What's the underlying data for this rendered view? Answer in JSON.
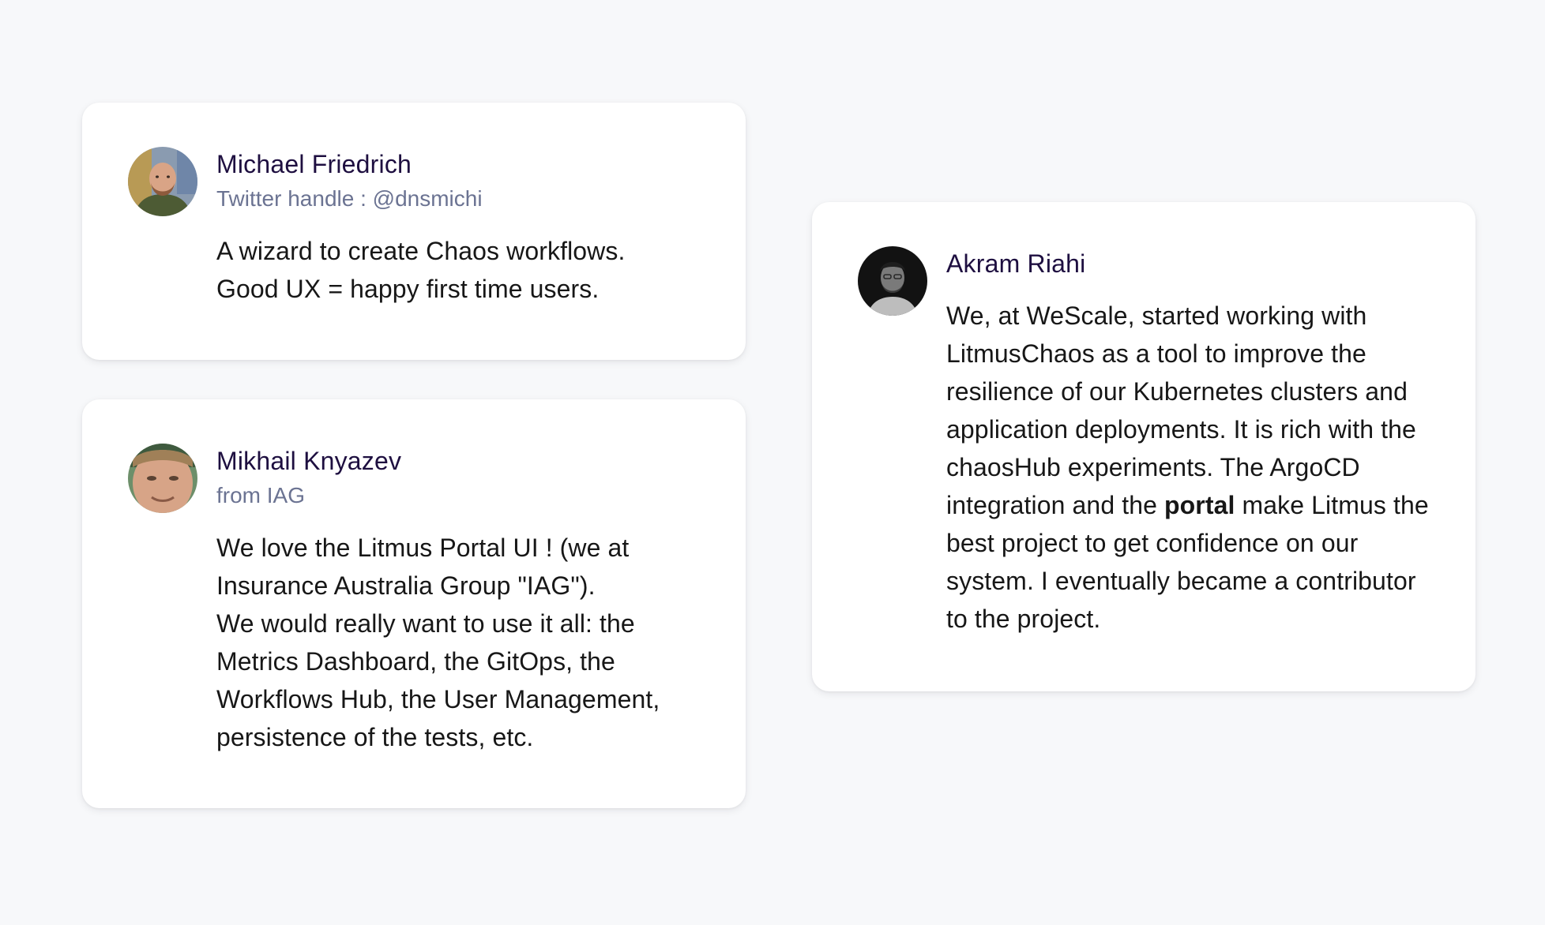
{
  "testimonials": [
    {
      "name": "Michael Friedrich",
      "subtitle": "Twitter handle : @dnsmichi",
      "quote_lines": [
        "A wizard to create Chaos workflows.",
        "Good UX = happy first time users."
      ]
    },
    {
      "name": "Mikhail Knyazev",
      "subtitle": "from IAG",
      "quote_lines": [
        "We love the Litmus Portal UI ! (we at Insurance Australia Group \"IAG\").",
        "We would really want to use it all: the Metrics Dashboard, the GitOps, the Workflows Hub, the User Management, persistence of the tests, etc."
      ]
    },
    {
      "name": "Akram Riahi",
      "quote_before_bold": "We, at WeScale, started working with LitmusChaos as a tool to improve the resilience of our Kubernetes clusters and application deployments. It is rich with the chaosHub experiments. The ArgoCD integration and the ",
      "quote_bold": "portal",
      "quote_after_bold": " make Litmus the best project to get confidence on our system. I eventually became a contributor to the project."
    }
  ],
  "colors": {
    "background": "#f7f8fa",
    "card": "#ffffff",
    "name": "#1e0f40",
    "subtitle": "#6b7392",
    "body_text": "#171717"
  }
}
